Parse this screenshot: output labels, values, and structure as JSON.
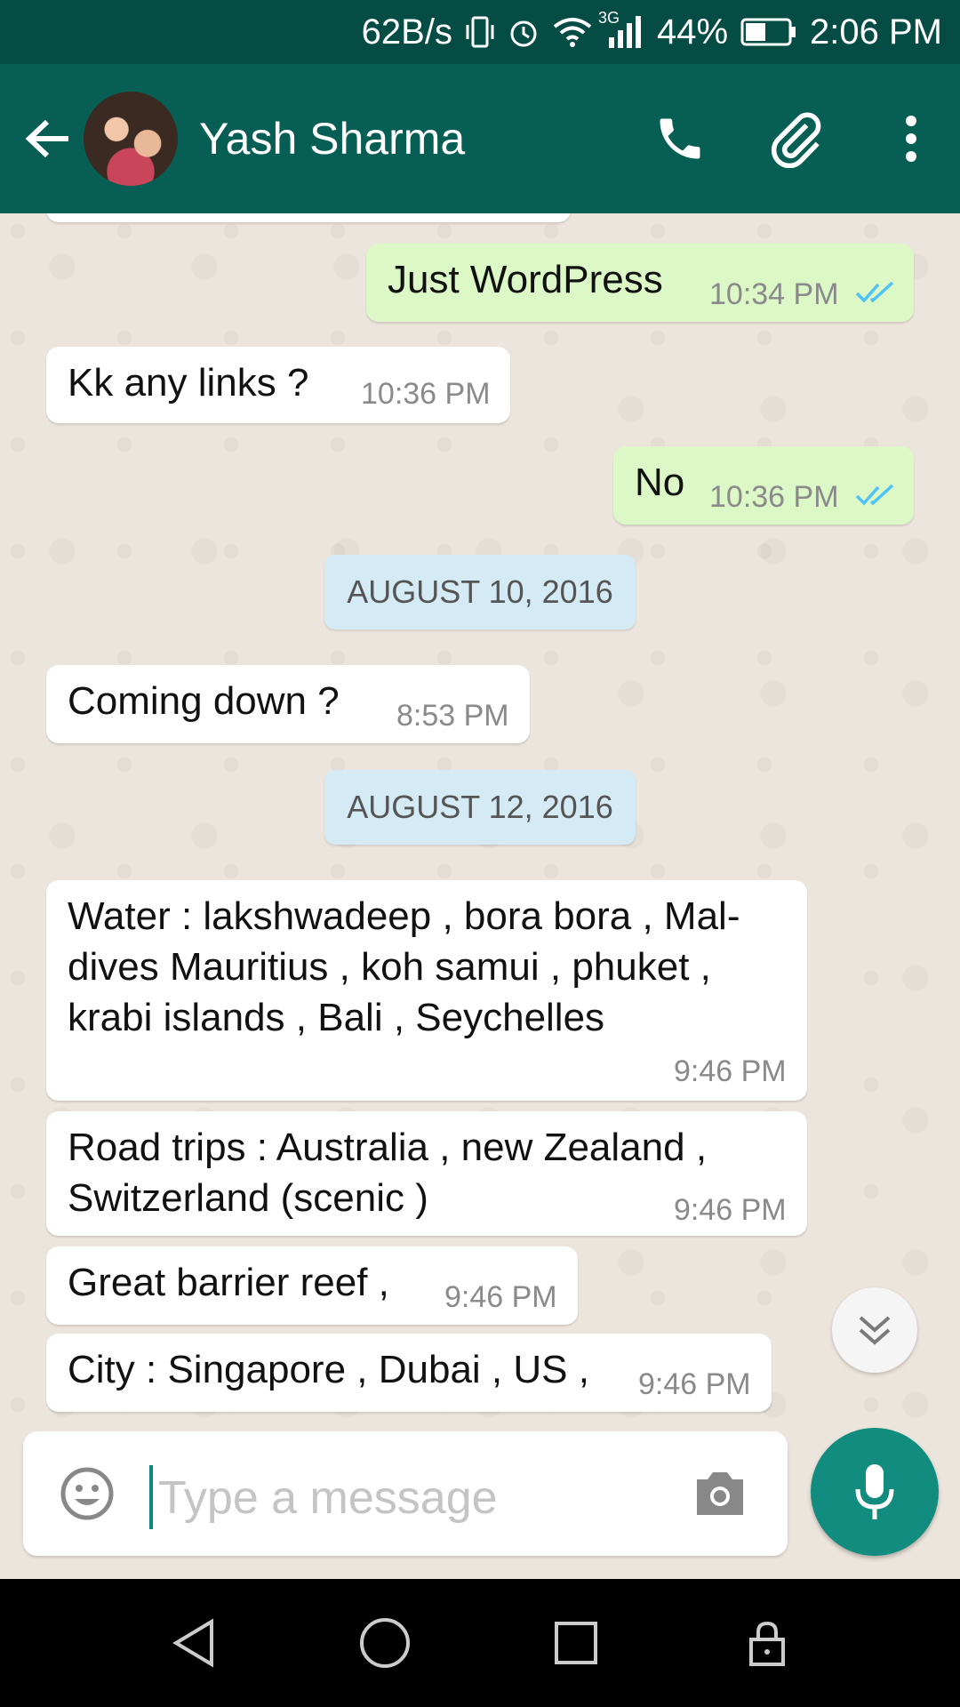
{
  "status_bar": {
    "net_speed": "62B/s",
    "network_type": "3G",
    "battery": "44%",
    "time": "2:06 PM",
    "icons": [
      "vibrate-icon",
      "alarm-icon",
      "wifi-icon",
      "signal-icon",
      "battery-icon"
    ]
  },
  "header": {
    "contact_name": "Yash Sharma",
    "icons": [
      "back-arrow-icon",
      "contact-avatar",
      "phone-icon",
      "attach-icon",
      "more-vert-icon"
    ]
  },
  "messages": [
    {
      "dir": "out",
      "text": "Just WordPress",
      "time": "10:34 PM",
      "read": true
    },
    {
      "dir": "in",
      "text": "Kk any links ?",
      "time": "10:36 PM"
    },
    {
      "dir": "out",
      "text": "No",
      "time": "10:36 PM",
      "read": true
    },
    {
      "dir": "in",
      "text": "Coming down ?",
      "time": "8:53 PM"
    },
    {
      "dir": "in",
      "text_lines": [
        "Water : lakshwadeep , bora bora , Mal-",
        "dives Mauritius , koh samui , phuket ,",
        "krabi islands , Bali , Seychelles"
      ],
      "time": "9:46 PM"
    },
    {
      "dir": "in",
      "text_lines": [
        "Road trips : Australia , new Zealand ,",
        "Switzerland (scenic )"
      ],
      "time": "9:46 PM"
    },
    {
      "dir": "in",
      "text": "Great barrier reef ,",
      "time": "9:46 PM"
    },
    {
      "dir": "in",
      "text": "City : Singapore , Dubai , US ,",
      "time": "9:46 PM"
    }
  ],
  "date_dividers": [
    "AUGUST 10, 2016",
    "AUGUST 12, 2016"
  ],
  "composer": {
    "placeholder": "Type a message",
    "value": ""
  },
  "colors": {
    "status_bar": "#054d44",
    "app_bar": "#075e54",
    "outgoing_bubble": "#dcf8c6",
    "incoming_bubble": "#ffffff",
    "date_chip": "#d4eaf4",
    "mic_button": "#128c7e",
    "read_ticks": "#4fc3f7"
  }
}
